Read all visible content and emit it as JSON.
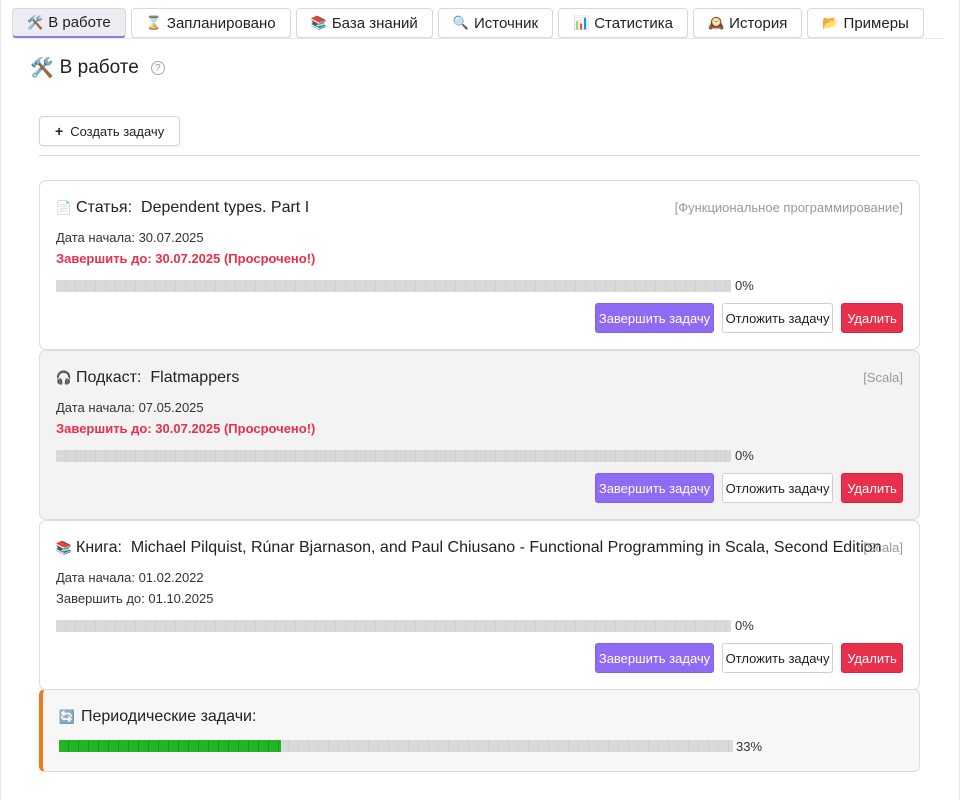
{
  "tabs": [
    {
      "icon": "🛠️",
      "label": "В работе",
      "active": true
    },
    {
      "icon": "⌛",
      "label": "Запланировано",
      "active": false
    },
    {
      "icon": "📚",
      "label": "База знаний",
      "active": false
    },
    {
      "icon": "🔍",
      "label": "Источник",
      "active": false
    },
    {
      "icon": "📊",
      "label": "Статистика",
      "active": false
    },
    {
      "icon": "🕰️",
      "label": "История",
      "active": false
    },
    {
      "icon": "📂",
      "label": "Примеры",
      "active": false
    }
  ],
  "page": {
    "icon": "🛠️",
    "title": "В работе",
    "help": "?",
    "create_button": "Создать задачу",
    "create_icon": "+"
  },
  "tasks": [
    {
      "icon": "📄",
      "type": "Статья:",
      "name": "Dependent types. Part I",
      "tag": "[Функциональное программирование]",
      "start": "Дата начала: 30.07.2025",
      "due": "Завершить до: 30.07.2025 (Просрочено!)",
      "overdue": true,
      "progress": 0,
      "progress_label": "0%",
      "complete": "Завершить задачу",
      "postpone": "Отложить задачу",
      "delete": "Удалить"
    },
    {
      "icon": "🎧",
      "type": "Подкаст:",
      "name": "Flatmappers",
      "tag": "[Scala]",
      "start": "Дата начала: 07.05.2025",
      "due": "Завершить до: 30.07.2025 (Просрочено!)",
      "overdue": true,
      "progress": 0,
      "progress_label": "0%",
      "complete": "Завершить задачу",
      "postpone": "Отложить задачу",
      "delete": "Удалить"
    },
    {
      "icon": "📚",
      "type": "Книга:",
      "name": "Michael Pilquist, Rúnar Bjarnason, and Paul Chiusano - Functional Programming in Scala, Second Edition",
      "tag": "[Scala]",
      "start": "Дата начала: 01.02.2022",
      "due": "Завершить до: 01.10.2025",
      "overdue": false,
      "progress": 0,
      "progress_label": "0%",
      "complete": "Завершить задачу",
      "postpone": "Отложить задачу",
      "delete": "Удалить"
    }
  ],
  "periodic": {
    "icon": "🔄",
    "title": "Периодические задачи:",
    "progress": 0.33,
    "progress_label": "33%"
  },
  "colors": {
    "accent": "#8f6af3",
    "danger": "#e8304a",
    "progress_fill": "#22b422",
    "periodic_border": "#f07a1a"
  }
}
